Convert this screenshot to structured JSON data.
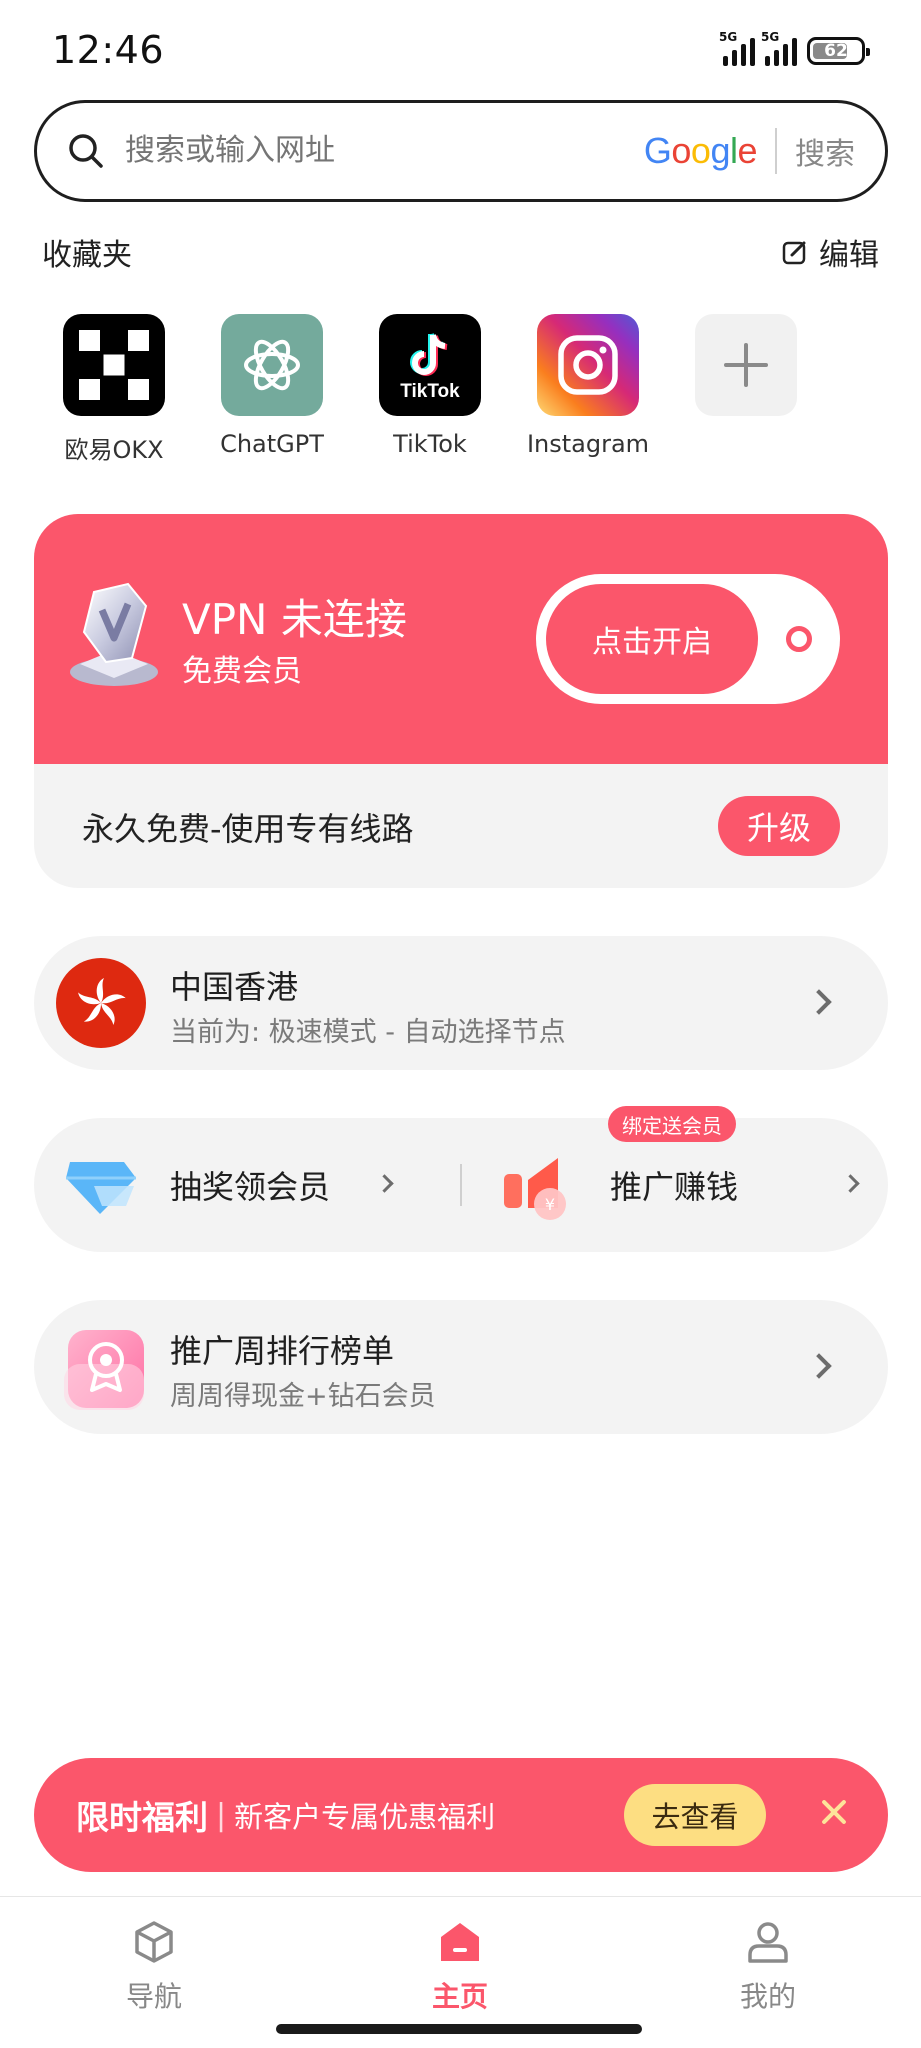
{
  "status_bar": {
    "time": "12:46",
    "signal1_tag": "5G",
    "signal2_tag": "5G",
    "battery": "62"
  },
  "search": {
    "placeholder": "搜索或输入网址",
    "engine": "Google",
    "button": "搜索"
  },
  "favorites": {
    "title": "收藏夹",
    "edit_label": "编辑",
    "items": [
      {
        "label": "欧易OKX",
        "icon": "okx-icon"
      },
      {
        "label": "ChatGPT",
        "icon": "chatgpt-icon"
      },
      {
        "label": "TikTok",
        "icon": "tiktok-icon"
      },
      {
        "label": "Instagram",
        "icon": "instagram-icon"
      },
      {
        "label": "",
        "icon": "add-icon"
      }
    ],
    "tiktok_wordmark": "TikTok"
  },
  "vpn": {
    "status": "VPN 未连接",
    "membership": "免费会员",
    "toggle_label": "点击开启",
    "promo_text": "永久免费-使用专有线路",
    "upgrade_label": "升级"
  },
  "node": {
    "title": "中国香港",
    "subtitle": "当前为: 极速模式 - 自动选择节点"
  },
  "actions": {
    "lottery_label": "抽奖领会员",
    "promote_label": "推广赚钱",
    "promote_badge": "绑定送会员"
  },
  "ranking": {
    "title": "推广周排行榜单",
    "subtitle": "周周得现金+钻石会员"
  },
  "promo_banner": {
    "highlight": "限时福利",
    "separator": "|",
    "text": "新客户专属优惠福利",
    "button": "去查看"
  },
  "tabbar": {
    "items": [
      {
        "label": "导航",
        "icon": "cube-icon"
      },
      {
        "label": "主页",
        "icon": "home-icon"
      },
      {
        "label": "我的",
        "icon": "user-icon"
      }
    ]
  },
  "colors": {
    "accent": "#fb566b",
    "card_bg": "#f3f3f3",
    "promo_button": "#fdde82"
  }
}
